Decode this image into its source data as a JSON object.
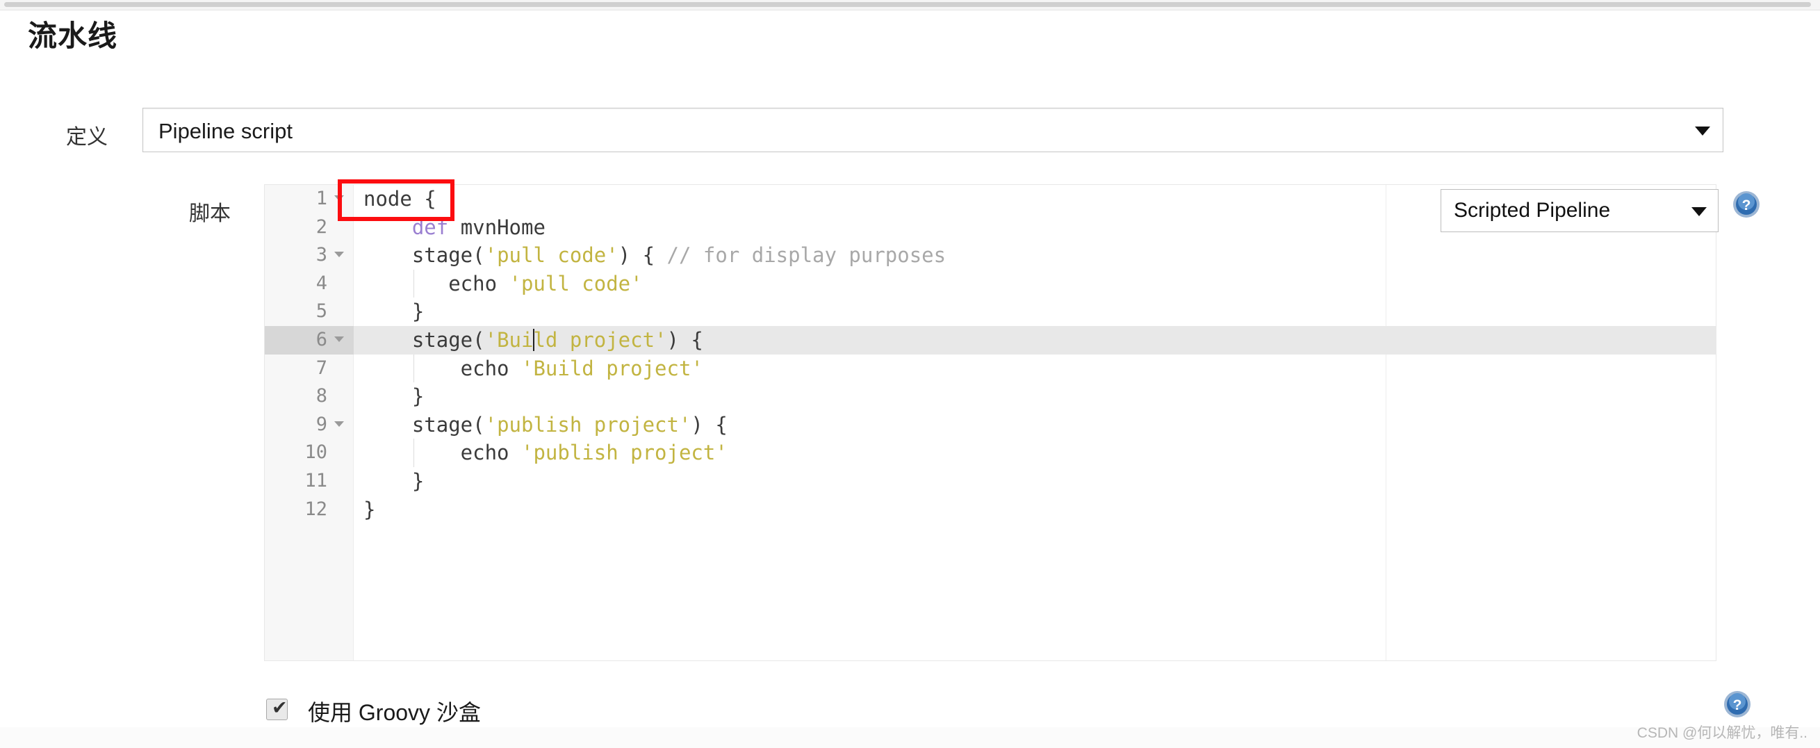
{
  "page": {
    "title": "流水线",
    "watermark": "CSDN @何以解忧，唯有.."
  },
  "definition": {
    "label": "定义",
    "selected": "Pipeline script",
    "caret_icon": "chevron-down-icon"
  },
  "script": {
    "label": "脚本",
    "pipeline_type": {
      "selected": "Scripted Pipeline",
      "caret_icon": "chevron-down-icon"
    },
    "lines": [
      {
        "n": "1",
        "fold": true,
        "tokens": [
          {
            "t": "plain",
            "v": "node {"
          }
        ]
      },
      {
        "n": "2",
        "fold": false,
        "tokens": [
          {
            "t": "plain",
            "v": "    "
          },
          {
            "t": "kw",
            "v": "def"
          },
          {
            "t": "plain",
            "v": " mvnHome"
          }
        ]
      },
      {
        "n": "3",
        "fold": true,
        "tokens": [
          {
            "t": "plain",
            "v": "    stage("
          },
          {
            "t": "str",
            "v": "'pull code'"
          },
          {
            "t": "plain",
            "v": ") { "
          },
          {
            "t": "com",
            "v": "// for display purposes"
          }
        ]
      },
      {
        "n": "4",
        "fold": false,
        "tokens": [
          {
            "t": "plain",
            "v": "       echo "
          },
          {
            "t": "str",
            "v": "'pull code'"
          }
        ]
      },
      {
        "n": "5",
        "fold": false,
        "tokens": [
          {
            "t": "plain",
            "v": "    }"
          }
        ]
      },
      {
        "n": "6",
        "fold": true,
        "tokens": [
          {
            "t": "plain",
            "v": "    stage("
          },
          {
            "t": "str",
            "v": "'Build project'"
          },
          {
            "t": "plain",
            "v": ") {"
          }
        ]
      },
      {
        "n": "7",
        "fold": false,
        "tokens": [
          {
            "t": "plain",
            "v": "        echo "
          },
          {
            "t": "str",
            "v": "'Build project'"
          }
        ]
      },
      {
        "n": "8",
        "fold": false,
        "tokens": [
          {
            "t": "plain",
            "v": "    }"
          }
        ]
      },
      {
        "n": "9",
        "fold": true,
        "tokens": [
          {
            "t": "plain",
            "v": "    stage("
          },
          {
            "t": "str",
            "v": "'publish project'"
          },
          {
            "t": "plain",
            "v": ") {"
          }
        ]
      },
      {
        "n": "10",
        "fold": false,
        "tokens": [
          {
            "t": "plain",
            "v": "        echo "
          },
          {
            "t": "str",
            "v": "'publish project'"
          }
        ]
      },
      {
        "n": "11",
        "fold": false,
        "tokens": [
          {
            "t": "plain",
            "v": "    }"
          }
        ]
      },
      {
        "n": "12",
        "fold": false,
        "tokens": [
          {
            "t": "plain",
            "v": "}"
          }
        ]
      }
    ],
    "active_line": 6,
    "cursor": {
      "line": 6,
      "column": 14
    }
  },
  "sandbox": {
    "label": "使用 Groovy 沙盒",
    "checked": true,
    "tick": "✔"
  },
  "annotation": {
    "highlight_text": "node {",
    "color": "#fc0d10"
  },
  "help": {
    "icon": "question-mark-circle-icon"
  }
}
